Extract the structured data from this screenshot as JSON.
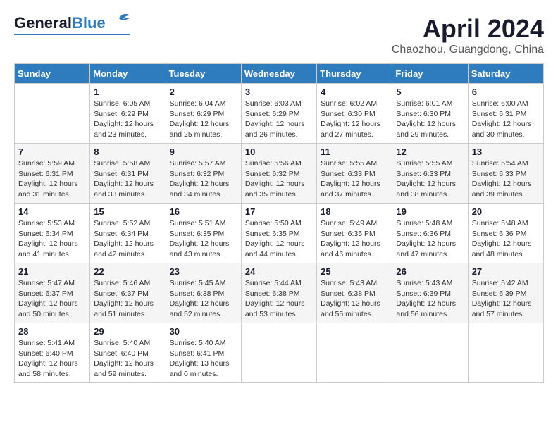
{
  "logo": {
    "line1": "General",
    "line2": "Blue"
  },
  "title": "April 2024",
  "subtitle": "Chaozhou, Guangdong, China",
  "days_of_week": [
    "Sunday",
    "Monday",
    "Tuesday",
    "Wednesday",
    "Thursday",
    "Friday",
    "Saturday"
  ],
  "weeks": [
    [
      {
        "day": "",
        "info": ""
      },
      {
        "day": "1",
        "info": "Sunrise: 6:05 AM\nSunset: 6:29 PM\nDaylight: 12 hours\nand 23 minutes."
      },
      {
        "day": "2",
        "info": "Sunrise: 6:04 AM\nSunset: 6:29 PM\nDaylight: 12 hours\nand 25 minutes."
      },
      {
        "day": "3",
        "info": "Sunrise: 6:03 AM\nSunset: 6:29 PM\nDaylight: 12 hours\nand 26 minutes."
      },
      {
        "day": "4",
        "info": "Sunrise: 6:02 AM\nSunset: 6:30 PM\nDaylight: 12 hours\nand 27 minutes."
      },
      {
        "day": "5",
        "info": "Sunrise: 6:01 AM\nSunset: 6:30 PM\nDaylight: 12 hours\nand 29 minutes."
      },
      {
        "day": "6",
        "info": "Sunrise: 6:00 AM\nSunset: 6:31 PM\nDaylight: 12 hours\nand 30 minutes."
      }
    ],
    [
      {
        "day": "7",
        "info": "Sunrise: 5:59 AM\nSunset: 6:31 PM\nDaylight: 12 hours\nand 31 minutes."
      },
      {
        "day": "8",
        "info": "Sunrise: 5:58 AM\nSunset: 6:31 PM\nDaylight: 12 hours\nand 33 minutes."
      },
      {
        "day": "9",
        "info": "Sunrise: 5:57 AM\nSunset: 6:32 PM\nDaylight: 12 hours\nand 34 minutes."
      },
      {
        "day": "10",
        "info": "Sunrise: 5:56 AM\nSunset: 6:32 PM\nDaylight: 12 hours\nand 35 minutes."
      },
      {
        "day": "11",
        "info": "Sunrise: 5:55 AM\nSunset: 6:33 PM\nDaylight: 12 hours\nand 37 minutes."
      },
      {
        "day": "12",
        "info": "Sunrise: 5:55 AM\nSunset: 6:33 PM\nDaylight: 12 hours\nand 38 minutes."
      },
      {
        "day": "13",
        "info": "Sunrise: 5:54 AM\nSunset: 6:33 PM\nDaylight: 12 hours\nand 39 minutes."
      }
    ],
    [
      {
        "day": "14",
        "info": "Sunrise: 5:53 AM\nSunset: 6:34 PM\nDaylight: 12 hours\nand 41 minutes."
      },
      {
        "day": "15",
        "info": "Sunrise: 5:52 AM\nSunset: 6:34 PM\nDaylight: 12 hours\nand 42 minutes."
      },
      {
        "day": "16",
        "info": "Sunrise: 5:51 AM\nSunset: 6:35 PM\nDaylight: 12 hours\nand 43 minutes."
      },
      {
        "day": "17",
        "info": "Sunrise: 5:50 AM\nSunset: 6:35 PM\nDaylight: 12 hours\nand 44 minutes."
      },
      {
        "day": "18",
        "info": "Sunrise: 5:49 AM\nSunset: 6:35 PM\nDaylight: 12 hours\nand 46 minutes."
      },
      {
        "day": "19",
        "info": "Sunrise: 5:48 AM\nSunset: 6:36 PM\nDaylight: 12 hours\nand 47 minutes."
      },
      {
        "day": "20",
        "info": "Sunrise: 5:48 AM\nSunset: 6:36 PM\nDaylight: 12 hours\nand 48 minutes."
      }
    ],
    [
      {
        "day": "21",
        "info": "Sunrise: 5:47 AM\nSunset: 6:37 PM\nDaylight: 12 hours\nand 50 minutes."
      },
      {
        "day": "22",
        "info": "Sunrise: 5:46 AM\nSunset: 6:37 PM\nDaylight: 12 hours\nand 51 minutes."
      },
      {
        "day": "23",
        "info": "Sunrise: 5:45 AM\nSunset: 6:38 PM\nDaylight: 12 hours\nand 52 minutes."
      },
      {
        "day": "24",
        "info": "Sunrise: 5:44 AM\nSunset: 6:38 PM\nDaylight: 12 hours\nand 53 minutes."
      },
      {
        "day": "25",
        "info": "Sunrise: 5:43 AM\nSunset: 6:38 PM\nDaylight: 12 hours\nand 55 minutes."
      },
      {
        "day": "26",
        "info": "Sunrise: 5:43 AM\nSunset: 6:39 PM\nDaylight: 12 hours\nand 56 minutes."
      },
      {
        "day": "27",
        "info": "Sunrise: 5:42 AM\nSunset: 6:39 PM\nDaylight: 12 hours\nand 57 minutes."
      }
    ],
    [
      {
        "day": "28",
        "info": "Sunrise: 5:41 AM\nSunset: 6:40 PM\nDaylight: 12 hours\nand 58 minutes."
      },
      {
        "day": "29",
        "info": "Sunrise: 5:40 AM\nSunset: 6:40 PM\nDaylight: 12 hours\nand 59 minutes."
      },
      {
        "day": "30",
        "info": "Sunrise: 5:40 AM\nSunset: 6:41 PM\nDaylight: 13 hours\nand 0 minutes."
      },
      {
        "day": "",
        "info": ""
      },
      {
        "day": "",
        "info": ""
      },
      {
        "day": "",
        "info": ""
      },
      {
        "day": "",
        "info": ""
      }
    ]
  ]
}
